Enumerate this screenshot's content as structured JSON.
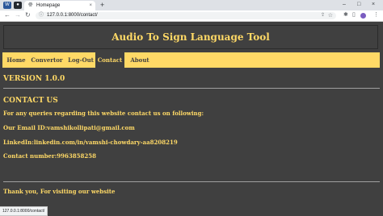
{
  "browser": {
    "pinned_tabs": [
      {
        "name": "word-pinned-tab",
        "glyph": "W",
        "color": "#2b579a"
      },
      {
        "name": "github-pinned-tab",
        "glyph": "●",
        "color": "#24292f"
      }
    ],
    "tab_title": "Homepage",
    "tab_close": "×",
    "new_tab": "+",
    "window_controls": {
      "minimize": "–",
      "maximize": "□",
      "close": "×"
    },
    "nav": {
      "back": "←",
      "forward": "→",
      "reload": "↻"
    },
    "url": "127.0.0.1:8000/contact/",
    "status_url": "127.0.0.1:8000/contact/"
  },
  "site": {
    "title": "Audio To Sign Language Tool",
    "nav": [
      "Home",
      "Convertor",
      "Log-Out",
      "Contact",
      "About"
    ],
    "active_nav": "Contact"
  },
  "content": {
    "version": "VERSION 1.0.0",
    "contact_heading": "CONTACT US",
    "intro": "For any queries regarding this website contact us on following:",
    "email": "Our Email ID:vamshikollipati@gmail.com",
    "linkedin": "LinkedIn:linkedin.com/in/vamshi-chowdary-aa8208219",
    "phone": "Contact number:9963858258",
    "thanks": "Thank you, For visiting our website"
  },
  "colors": {
    "background": "#404040",
    "accent": "#ffd966"
  }
}
